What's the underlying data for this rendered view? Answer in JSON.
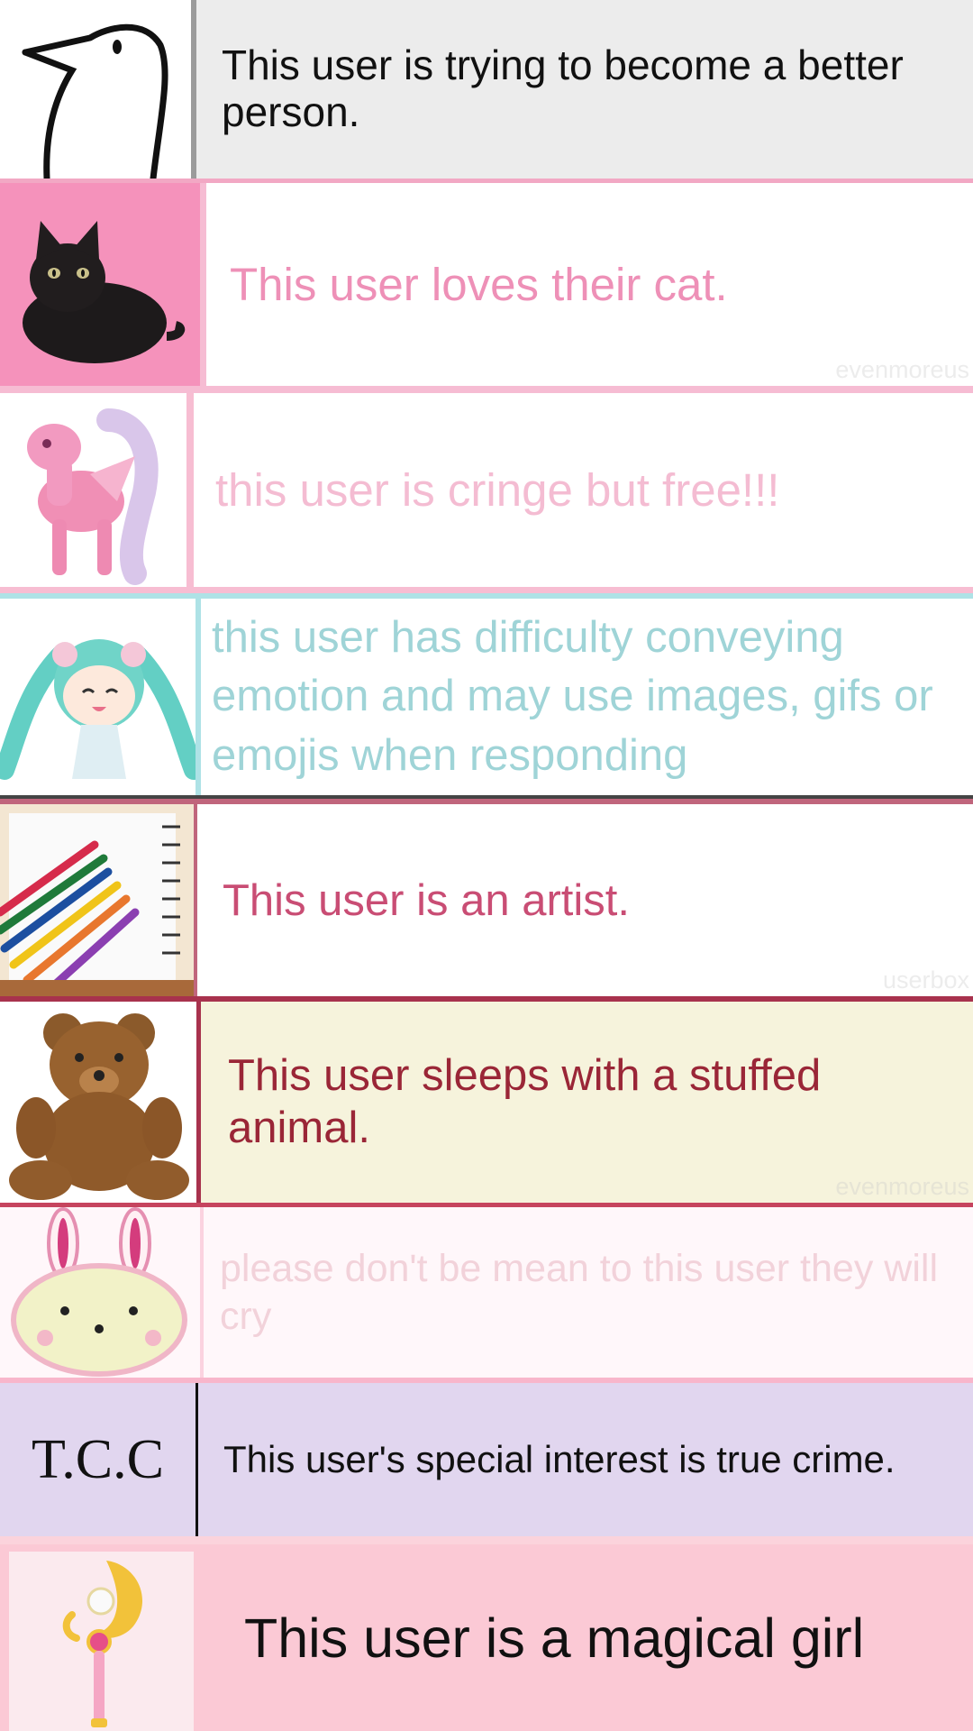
{
  "userboxes": [
    {
      "text": "This user is trying to become a better person.",
      "icon": "penguin-doodle-icon"
    },
    {
      "text": "This user loves their cat.",
      "icon": "black-cat-icon",
      "watermark": "evenmoreus"
    },
    {
      "text": "this user is cringe but free!!!",
      "icon": "pink-pony-icon"
    },
    {
      "text": "this user has difficulty conveying emotion and may use images, gifs or emojis when responding",
      "icon": "chibi-girl-icon"
    },
    {
      "text": "This user is an artist.",
      "icon": "colored-pencils-icon",
      "watermark": "userbox"
    },
    {
      "text": "This user sleeps with a stuffed animal.",
      "icon": "teddy-bear-icon",
      "watermark": "evenmoreus"
    },
    {
      "text": "please don't be mean to this user they will cry",
      "icon": "bunny-icon"
    },
    {
      "text": "This user's special interest is true crime.",
      "icon_text": "T.C.C"
    },
    {
      "text": "This user is a magical girl",
      "icon": "moon-wand-icon"
    }
  ],
  "colors": {
    "pink": "#f592bb",
    "light_pink": "#f6bcd3",
    "teal": "#aee2e6",
    "crimson": "#a8324d",
    "cream": "#f6f3dc",
    "lavender": "#e1d6ef",
    "blush": "#fbc9d5"
  }
}
